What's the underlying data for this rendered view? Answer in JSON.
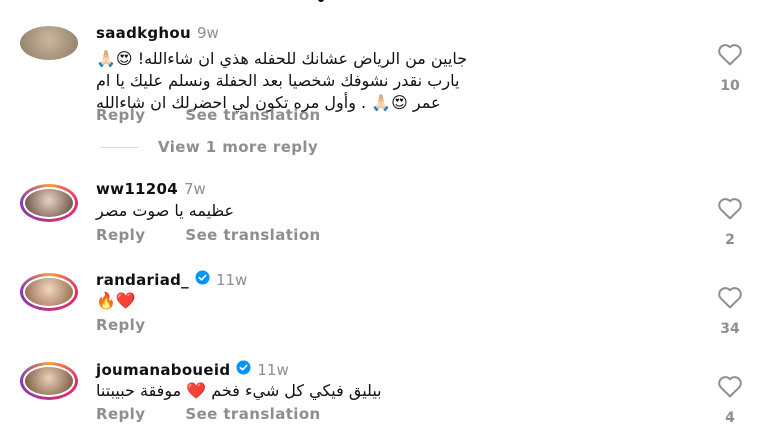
{
  "comments": [
    {
      "username": "saadkghou",
      "time": "9w",
      "verified": false,
      "text_lines": [
        "جايين من الرياض عشانك للحفله هذي ان شاءالله! 😍🙏🏻",
        "يارب نقدر نشوفك شخصيا بعد الحفلة ونسلم عليك يا ام",
        "عمر 😍🙏🏻 . وأول مره تكون لي احضرلك ان شاءالله"
      ],
      "reply_label": "Reply",
      "translate_label": "See translation",
      "likes": "10"
    },
    {
      "username": "ww11204",
      "time": "7w",
      "verified": false,
      "text_lines": [
        "عظيمه يا صوت مصر"
      ],
      "reply_label": "Reply",
      "translate_label": "See translation",
      "likes": "2"
    },
    {
      "username": "randariad_",
      "time": "11w",
      "verified": true,
      "text_lines": [
        "🔥❤️"
      ],
      "reply_label": "Reply",
      "likes": "34"
    },
    {
      "username": "joumanaboueid",
      "time": "11w",
      "verified": true,
      "text_lines": [
        "بيليق فيكي كل شيء فخم ❤️ موفقة حبيبتنا"
      ],
      "reply_label": "Reply",
      "translate_label": "See translation",
      "likes": "4"
    }
  ],
  "view_more_replies": "View 1 more reply",
  "icons": {
    "like": "heart-outline-icon",
    "verified": "verified-badge-icon"
  },
  "colors": {
    "muted": "#8e8e8e",
    "verified_blue": "#0095f6"
  }
}
